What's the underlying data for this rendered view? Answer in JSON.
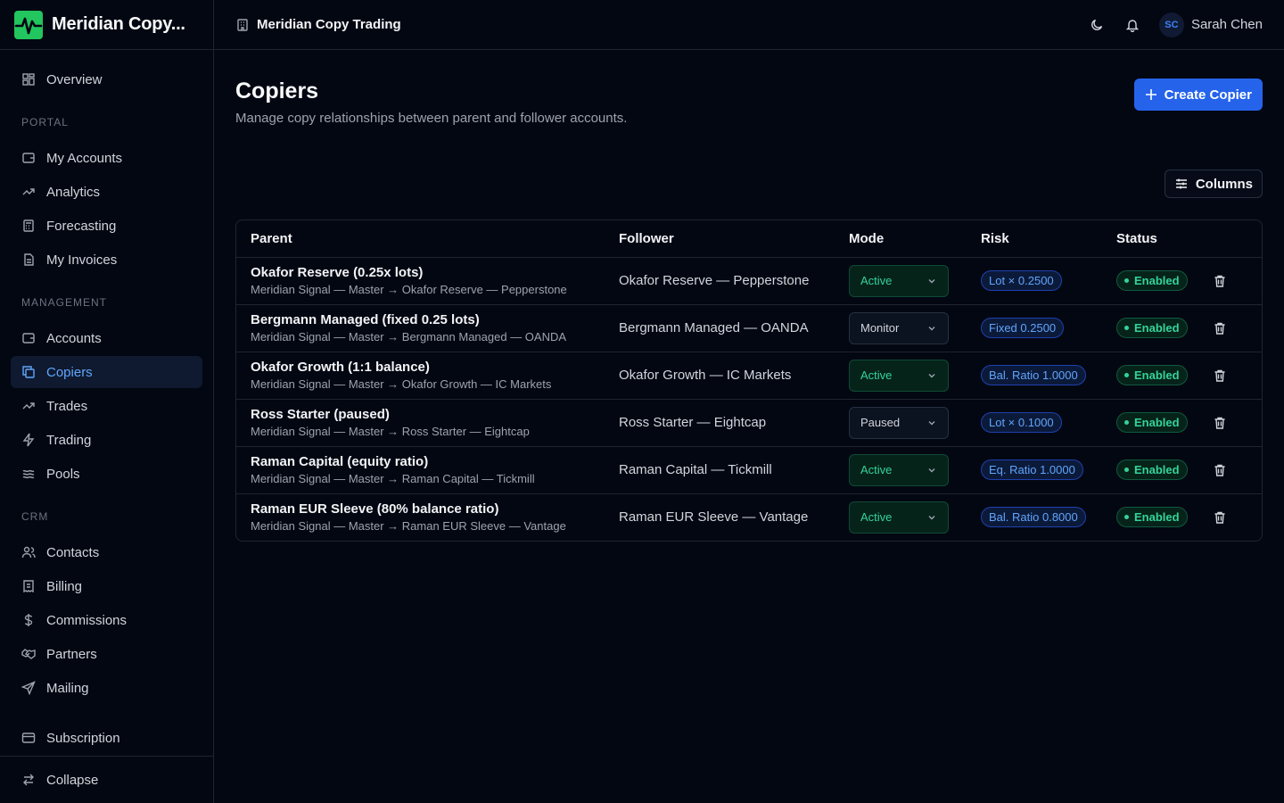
{
  "brand": {
    "name": "Meridian Copy...",
    "accent": "#22c55e"
  },
  "header": {
    "breadcrumb": "Meridian Copy Trading",
    "user": {
      "initials": "SC",
      "name": "Sarah Chen"
    }
  },
  "sidebar": {
    "overview": "Overview",
    "sections": {
      "portal": "PORTAL",
      "management": "MANAGEMENT",
      "crm": "CRM"
    },
    "portal_items": [
      "My Accounts",
      "Analytics",
      "Forecasting",
      "My Invoices"
    ],
    "management_items": [
      "Accounts",
      "Copiers",
      "Trades",
      "Trading",
      "Pools"
    ],
    "crm_items": [
      "Contacts",
      "Billing",
      "Commissions",
      "Partners",
      "Mailing"
    ],
    "subscription": "Subscription",
    "collapse": "Collapse",
    "active_item": "Copiers"
  },
  "page": {
    "title": "Copiers",
    "subtitle": "Manage copy relationships between parent and follower accounts.",
    "create_label": "Create Copier",
    "columns_label": "Columns"
  },
  "table": {
    "headers": [
      "Parent",
      "Follower",
      "Mode",
      "Risk",
      "Status"
    ],
    "rows": [
      {
        "parent": "Okafor Reserve (0.25x lots)",
        "path": "Meridian Signal — Master → Okafor Reserve — Pepperstone",
        "follower": "Okafor Reserve — Pepperstone",
        "mode": "Active",
        "risk": "Lot × 0.2500",
        "status": "Enabled"
      },
      {
        "parent": "Bergmann Managed (fixed 0.25 lots)",
        "path": "Meridian Signal — Master → Bergmann Managed — OANDA",
        "follower": "Bergmann Managed — OANDA",
        "mode": "Monitor",
        "risk": "Fixed 0.2500",
        "status": "Enabled"
      },
      {
        "parent": "Okafor Growth (1:1 balance)",
        "path": "Meridian Signal — Master → Okafor Growth — IC Markets",
        "follower": "Okafor Growth — IC Markets",
        "mode": "Active",
        "risk": "Bal. Ratio 1.0000",
        "status": "Enabled"
      },
      {
        "parent": "Ross Starter (paused)",
        "path": "Meridian Signal — Master → Ross Starter — Eightcap",
        "follower": "Ross Starter — Eightcap",
        "mode": "Paused",
        "risk": "Lot × 0.1000",
        "status": "Enabled"
      },
      {
        "parent": "Raman Capital (equity ratio)",
        "path": "Meridian Signal — Master → Raman Capital — Tickmill",
        "follower": "Raman Capital — Tickmill",
        "mode": "Active",
        "risk": "Eq. Ratio 1.0000",
        "status": "Enabled"
      },
      {
        "parent": "Raman EUR Sleeve (80% balance ratio)",
        "path": "Meridian Signal — Master → Raman EUR Sleeve — Vantage",
        "follower": "Raman EUR Sleeve — Vantage",
        "mode": "Active",
        "risk": "Bal. Ratio 0.8000",
        "status": "Enabled"
      }
    ]
  },
  "colors": {
    "primary": "#2563eb",
    "success": "#34d399",
    "risk": "#60a5fa"
  }
}
